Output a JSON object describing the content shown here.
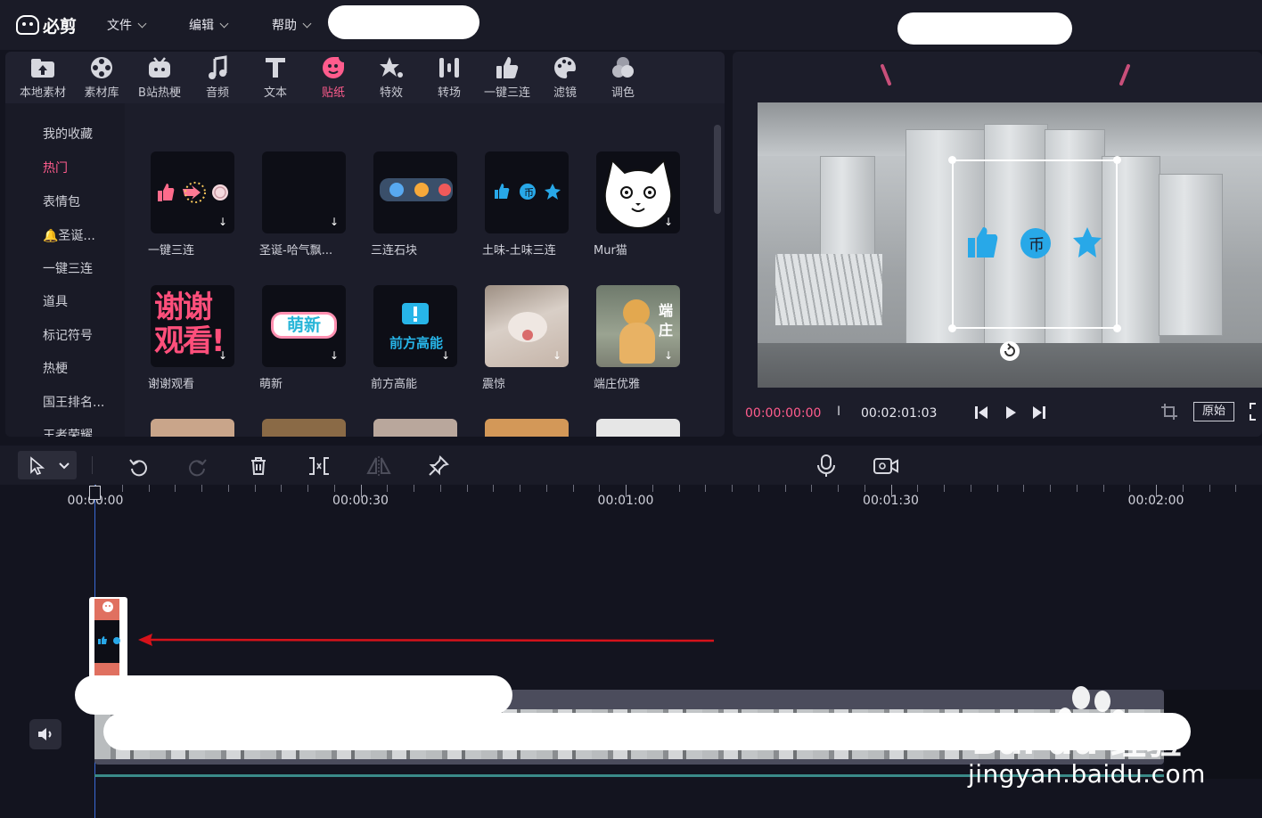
{
  "app": {
    "name": "必剪"
  },
  "menu": {
    "file": "文件",
    "edit": "编辑",
    "help": "帮助"
  },
  "toolbar": {
    "items": [
      {
        "label": "本地素材",
        "icon": "upload-folder-icon"
      },
      {
        "label": "素材库",
        "icon": "film-reel-icon"
      },
      {
        "label": "B站热梗",
        "icon": "bilibili-tv-icon"
      },
      {
        "label": "音频",
        "icon": "music-note-icon"
      },
      {
        "label": "文本",
        "icon": "text-t-icon"
      },
      {
        "label": "贴纸",
        "icon": "sticker-face-icon",
        "active": true
      },
      {
        "label": "特效",
        "icon": "sparkle-star-icon"
      },
      {
        "label": "转场",
        "icon": "transition-bars-icon"
      },
      {
        "label": "一键三连",
        "icon": "thumbs-up-icon"
      },
      {
        "label": "滤镜",
        "icon": "palette-icon"
      },
      {
        "label": "调色",
        "icon": "color-circles-icon"
      }
    ]
  },
  "categories": [
    "我的收藏",
    "热门",
    "表情包",
    "🔔圣诞...",
    "一键三连",
    "道具",
    "标记符号",
    "热梗",
    "国王排名...",
    "王者荣耀"
  ],
  "active_category": "热门",
  "stickers": [
    {
      "label": "一键三连"
    },
    {
      "label": "圣诞-哈气飘..."
    },
    {
      "label": "三连石块"
    },
    {
      "label": "土味-土味三连"
    },
    {
      "label": "Mur猫"
    },
    {
      "label": "谢谢观看",
      "art": "谢谢观看!"
    },
    {
      "label": "萌新",
      "art": "萌新"
    },
    {
      "label": "前方高能",
      "art": "前方高能"
    },
    {
      "label": "震惊"
    },
    {
      "label": "端庄优雅",
      "art": "端庄"
    }
  ],
  "preview": {
    "current_time": "00:00:00:00",
    "separator": "I",
    "total_time": "00:02:01:03",
    "original_label": "原始"
  },
  "timeline": {
    "ticks": [
      "00:00:00",
      "00:00:30",
      "00:01:00",
      "00:01:30",
      "00:02:00"
    ]
  },
  "watermark": {
    "brand": "Bai du 经验",
    "url": "jingyan.baidu.com"
  },
  "colors": {
    "accent": "#ff5c8d",
    "background": "#13141f",
    "panel": "#1c1d2a",
    "annotation_arrow": "#d6121a"
  }
}
